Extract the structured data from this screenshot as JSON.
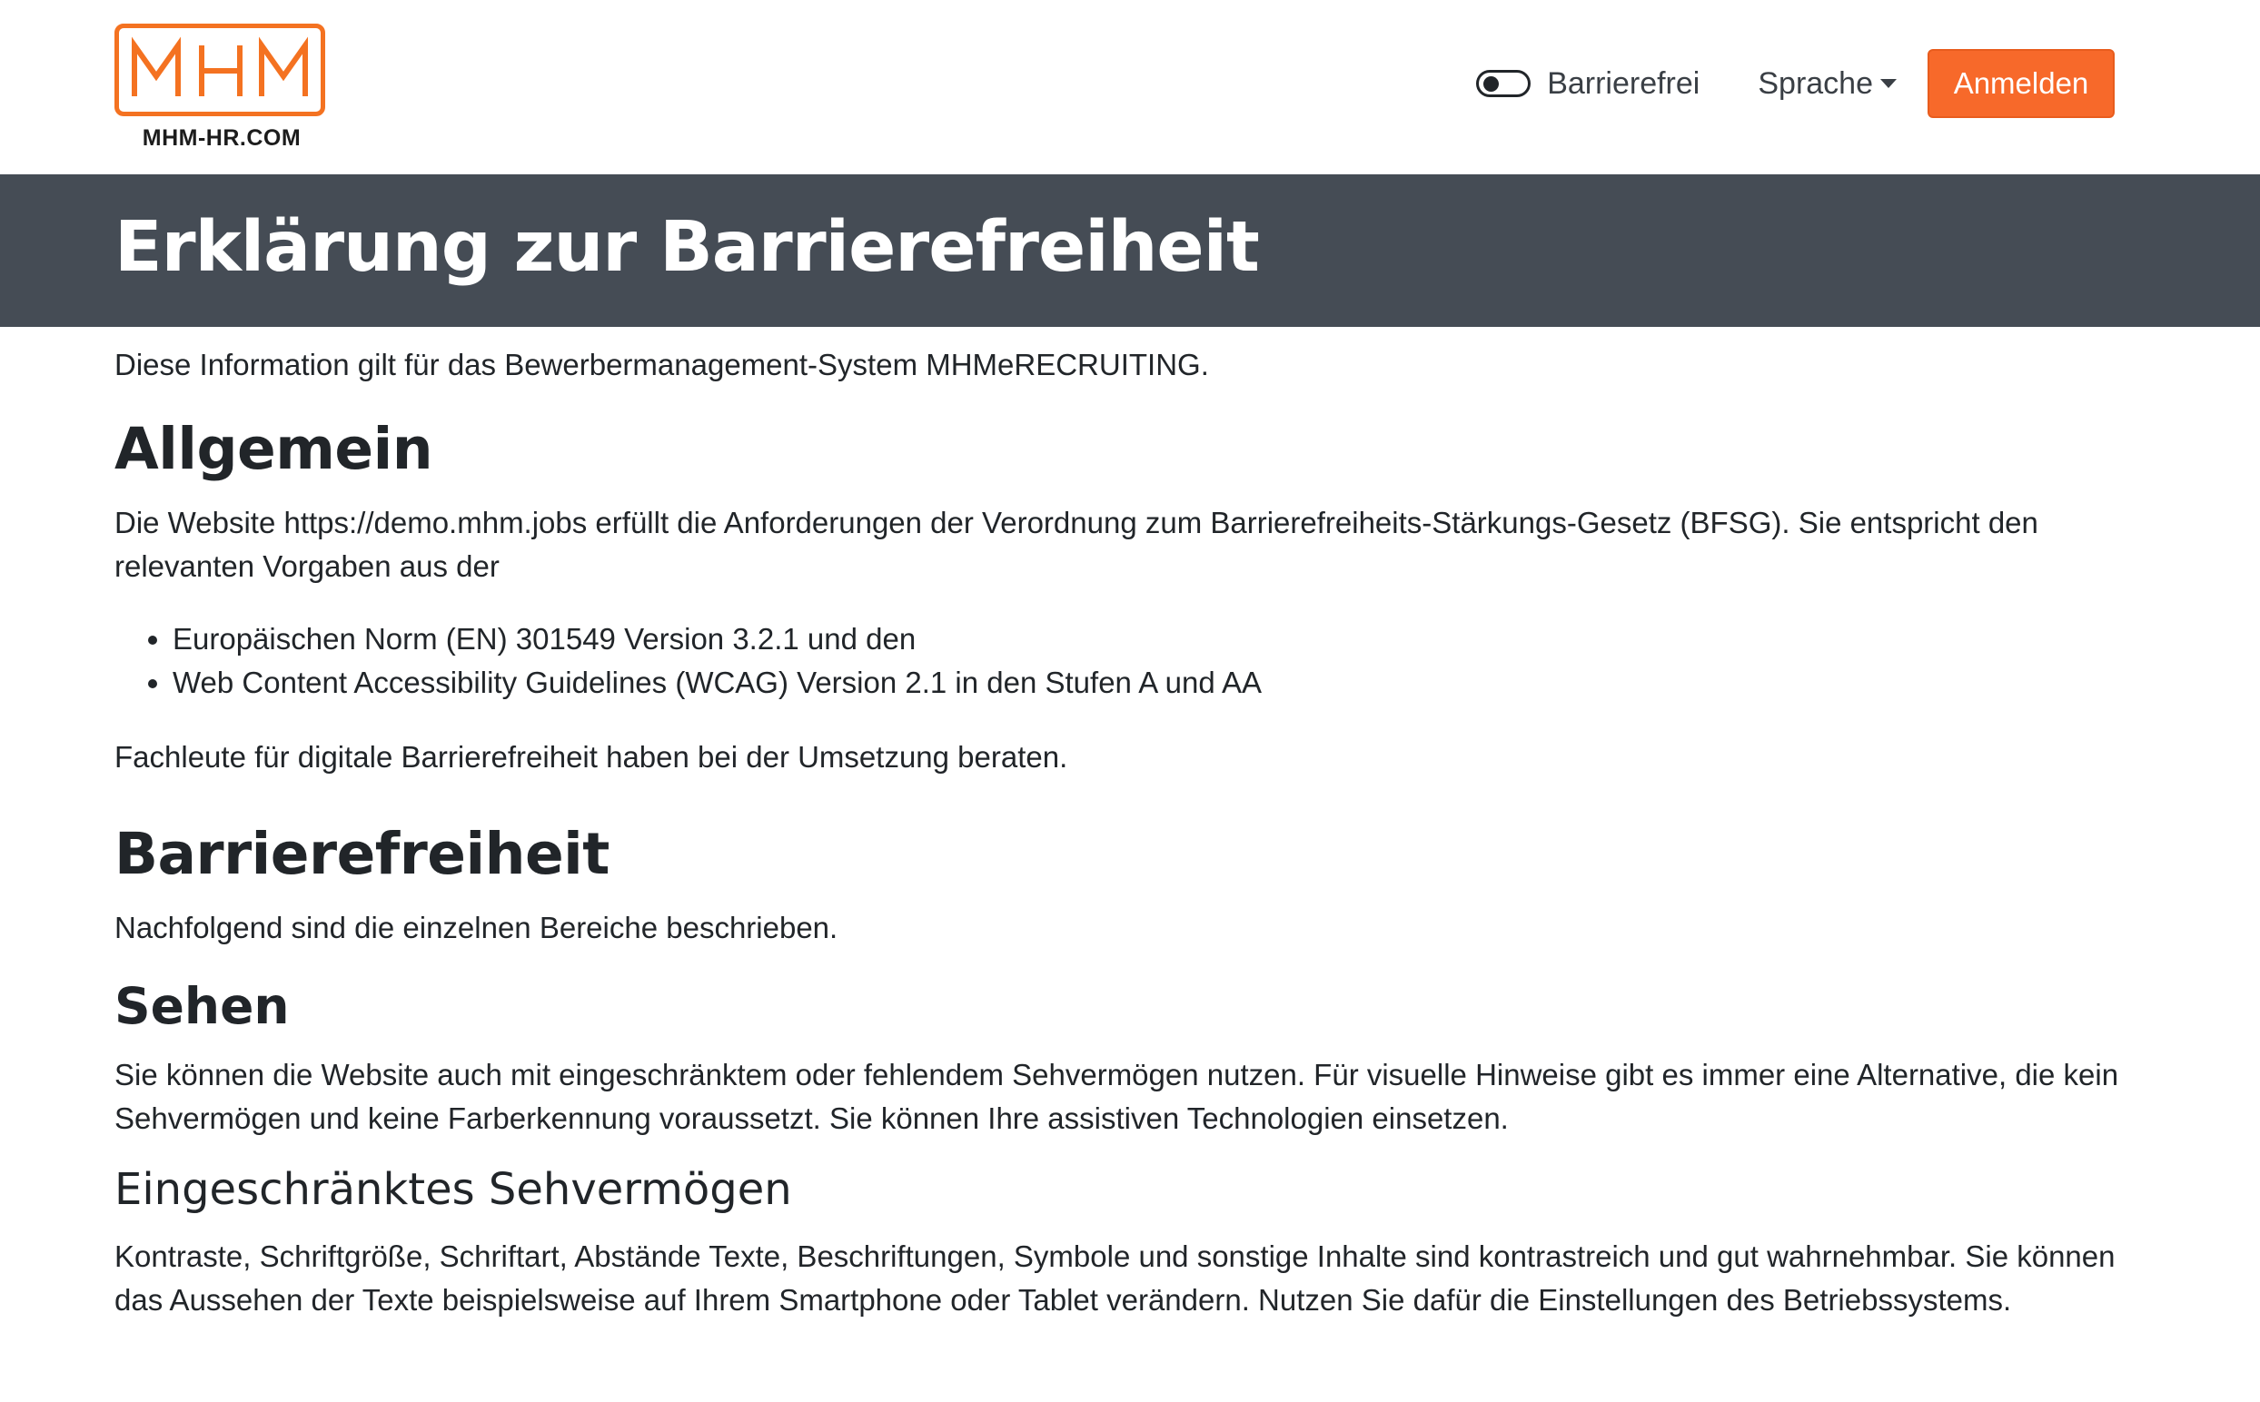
{
  "header": {
    "logo_text": "MHM",
    "logo_subtext": "MHM-HR.COM",
    "accessibility_toggle_label": "Barrierefrei",
    "language_label": "Sprache",
    "login_label": "Anmelden",
    "colors": {
      "brand": "#f47221",
      "button": "#f7692a",
      "banner": "#454c55"
    }
  },
  "banner": {
    "title": "Erklärung zur Barrierefreiheit"
  },
  "main": {
    "intro": "Diese Information gilt für das Bewerbermanagement-System MHMeRECRUITING.",
    "general": {
      "heading": "Allgemein",
      "paragraph": "Die Website https://demo.mhm.jobs erfüllt die Anforderungen der Verordnung zum Barrierefreiheits-Stärkungs-Gesetz (BFSG). Sie entspricht den relevanten Vorgaben aus der",
      "bullets": [
        "Europäischen Norm (EN) 301549 Version 3.2.1 und den",
        "Web Content Accessibility Guidelines (WCAG) Version 2.1 in den Stufen A und AA"
      ],
      "note": "Fachleute für digitale Barrierefreiheit haben bei der Umsetzung beraten."
    },
    "accessibility": {
      "heading": "Barrierefreiheit",
      "paragraph": "Nachfolgend sind die einzelnen Bereiche beschrieben."
    },
    "seeing": {
      "heading": "Sehen",
      "paragraph": "Sie können die Website auch mit eingeschränktem oder fehlendem Sehvermögen nutzen. Für visuelle Hinweise gibt es immer eine Alternative, die kein Sehvermögen und keine Farberkennung voraussetzt. Sie können Ihre assistiven Technologien einsetzen."
    },
    "limited_vision": {
      "heading": "Eingeschränktes Sehvermögen",
      "paragraph": "Kontraste, Schriftgröße, Schriftart, Abstände Texte, Beschriftungen, Symbole und sonstige Inhalte sind kontrastreich und gut wahrnehmbar. Sie können das Aussehen der Texte beispielsweise auf Ihrem Smartphone oder Tablet verändern. Nutzen Sie dafür die Einstellungen des Betriebssystems."
    }
  }
}
